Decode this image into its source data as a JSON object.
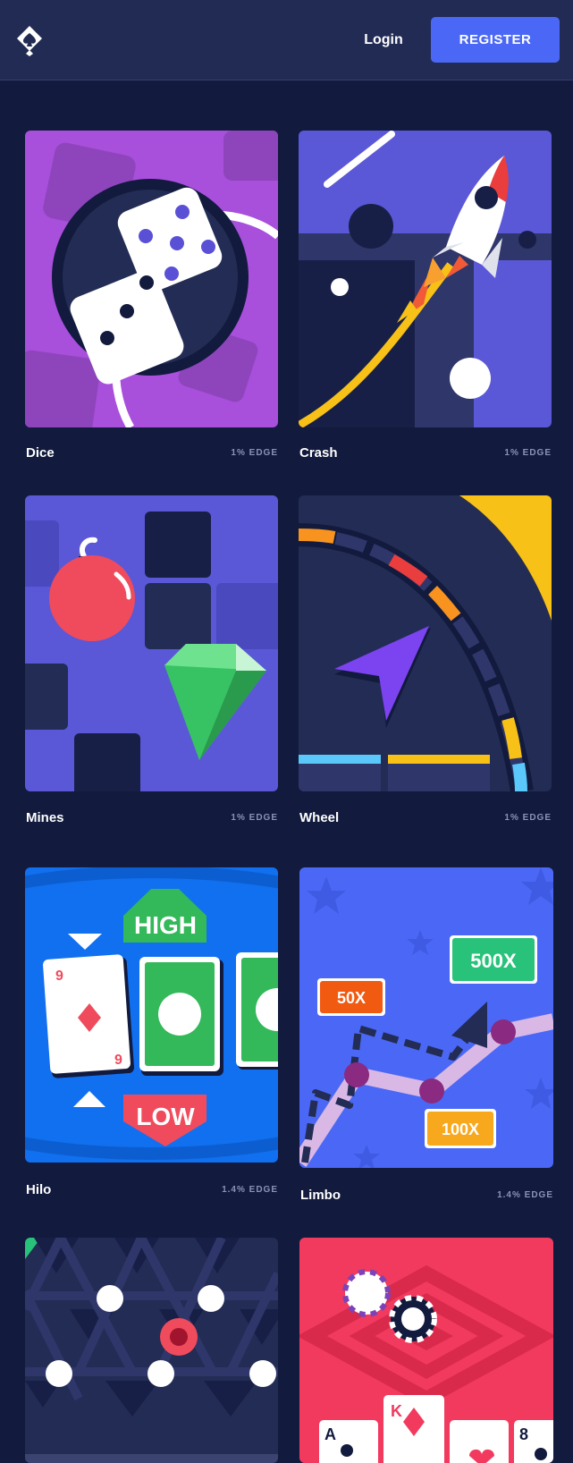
{
  "header": {
    "login_label": "Login",
    "register_label": "REGISTER",
    "colors": {
      "background": "#222b54",
      "register": "#4a68f5",
      "page": "#121a3d"
    }
  },
  "games": [
    {
      "name": "Dice",
      "edge": "1% EDGE"
    },
    {
      "name": "Crash",
      "edge": "1% EDGE"
    },
    {
      "name": "Mines",
      "edge": "1% EDGE"
    },
    {
      "name": "Wheel",
      "edge": "1% EDGE"
    },
    {
      "name": "Hilo",
      "edge": "1.4% EDGE"
    },
    {
      "name": "Limbo",
      "edge": "1.4% EDGE"
    }
  ],
  "art": {
    "hilo_high": "HIGH",
    "hilo_low": "LOW",
    "hilo_card_rank": "9",
    "limbo_labels": [
      "50X",
      "500X",
      "100X"
    ],
    "poker_ranks": [
      "K",
      "A",
      "8"
    ]
  }
}
